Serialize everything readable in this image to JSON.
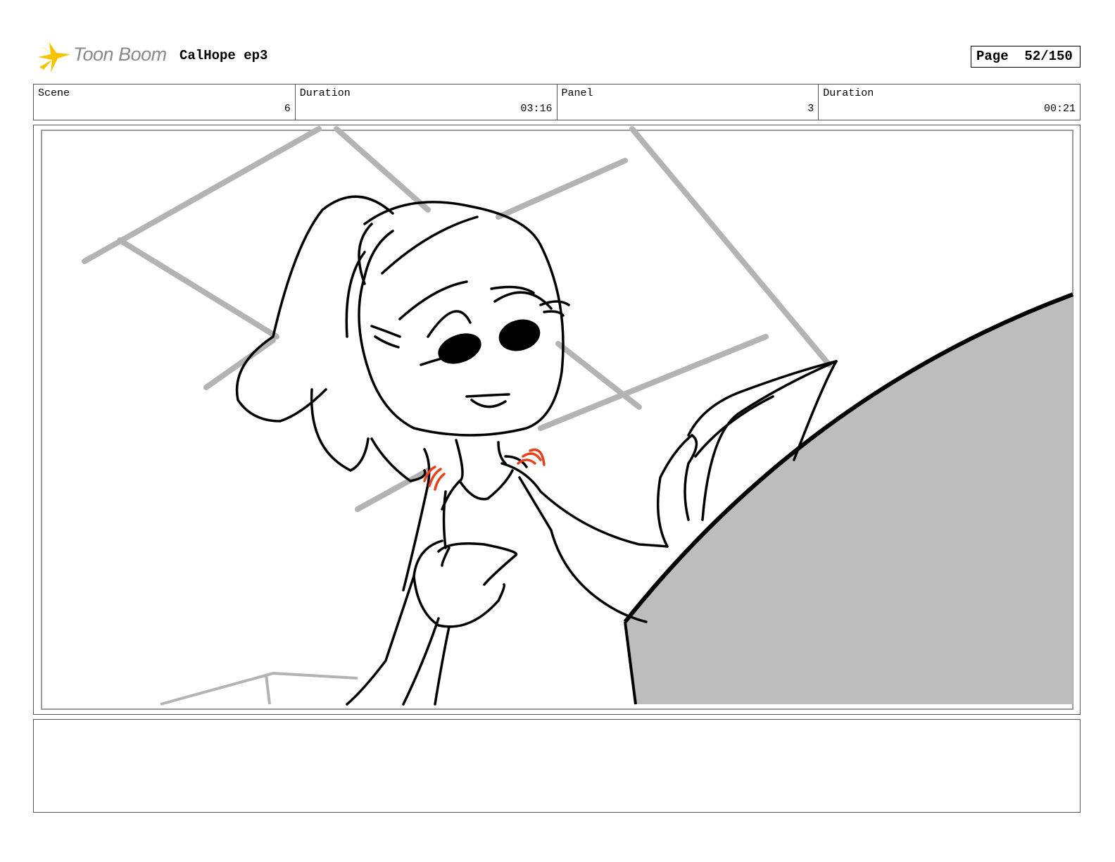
{
  "header": {
    "logo_text": "Toon Boom",
    "project_title": "CalHope ep3",
    "page_label": "Page",
    "page_value": "52/150"
  },
  "info": {
    "scene_label": "Scene",
    "scene_value": "6",
    "scene_duration_label": "Duration",
    "scene_duration_value": "03:16",
    "panel_label": "Panel",
    "panel_value": "3",
    "panel_duration_label": "Duration",
    "panel_duration_value": "00:21"
  },
  "notes": {
    "text": ""
  },
  "colors": {
    "sketch_line": "#000000",
    "background_lines": "#b3b3b3",
    "foreground_fill": "#bdbdbd",
    "action_marks": "#e8401c",
    "logo_burst": "#f5c400"
  }
}
